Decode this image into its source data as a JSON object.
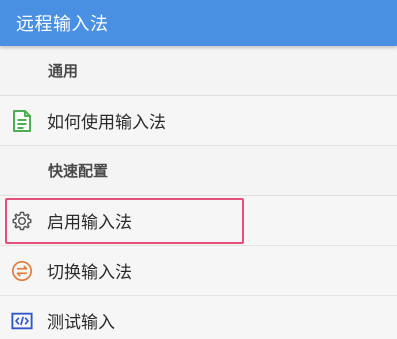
{
  "app_bar": {
    "title": "远程输入法",
    "color": "#4a90e2"
  },
  "sections": [
    {
      "header": "通用",
      "items": [
        {
          "label": "如何使用输入法",
          "icon": "document-icon",
          "icon_color": "#4caf50"
        }
      ]
    },
    {
      "header": "快速配置",
      "items": [
        {
          "label": "启用输入法",
          "icon": "gear-icon",
          "icon_color": "#555555",
          "highlighted": true
        },
        {
          "label": "切换输入法",
          "icon": "switch-icon",
          "icon_color": "#e07b39"
        },
        {
          "label": "测试输入",
          "icon": "code-icon",
          "icon_color": "#2d56c8"
        }
      ]
    }
  ],
  "highlight_color": "#e4507a"
}
